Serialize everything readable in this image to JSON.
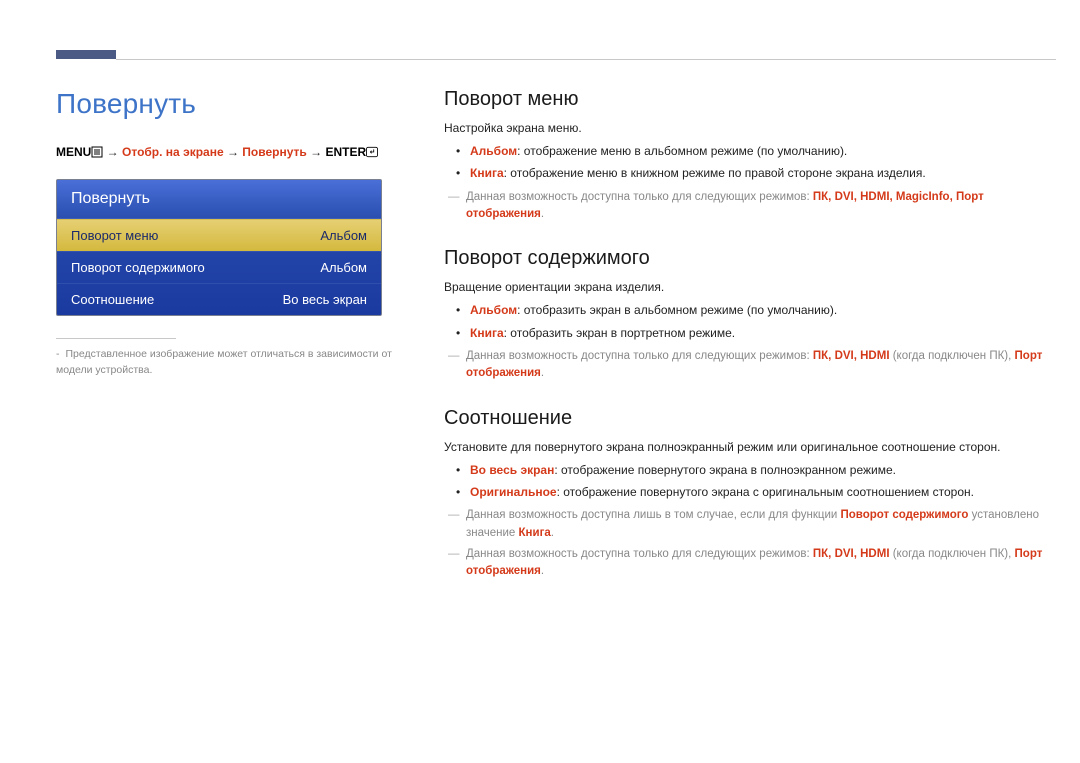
{
  "page_title": "Повернуть",
  "breadcrumb": {
    "menu_label": "MENU",
    "arrow": " → ",
    "p1": "Отобр. на экране",
    "p2": "Повернуть",
    "enter_label": "ENTER"
  },
  "osd": {
    "title": "Повернуть",
    "rows": [
      {
        "label": "Поворот меню",
        "value": "Альбом",
        "selected": true
      },
      {
        "label": "Поворот содержимого",
        "value": "Альбом",
        "selected": false
      },
      {
        "label": "Соотношение",
        "value": "Во весь экран",
        "selected": false
      }
    ]
  },
  "left_footnote": "Представленное изображение может отличаться в зависимости от модели устройства.",
  "sections": {
    "menu_rotate": {
      "heading": "Поворот меню",
      "desc": "Настройка экрана меню.",
      "bullets": [
        {
          "term": "Альбом",
          "text": ": отображение меню в альбомном режиме (по умолчанию)."
        },
        {
          "term": "Книга",
          "text": ": отображение меню в книжном режиме по правой стороне экрана изделия."
        }
      ],
      "note_prefix": "Данная возможность доступна только для следующих режимов: ",
      "note_modes": "ПК, DVI, HDMI, MagicInfo, Порт отображения",
      "note_suffix": "."
    },
    "content_rotate": {
      "heading": "Поворот содержимого",
      "desc": "Вращение ориентации экрана изделия.",
      "bullets": [
        {
          "term": "Альбом",
          "text": ": отобразить экран в альбомном режиме (по умолчанию)."
        },
        {
          "term": "Книга",
          "text": ": отобразить экран в портретном режиме."
        }
      ],
      "note_prefix": "Данная возможность доступна только для следующих режимов: ",
      "note_modes": "ПК, DVI, HDMI",
      "note_mid": " (когда подключен ПК), ",
      "note_modes2": "Порт отображения",
      "note_suffix": "."
    },
    "ratio": {
      "heading": "Соотношение",
      "desc": "Установите для повернутого экрана полноэкранный режим или оригинальное соотношение сторон.",
      "bullets": [
        {
          "term": "Во весь экран",
          "text": ": отображение повернутого экрана в полноэкранном режиме."
        },
        {
          "term": "Оригинальное",
          "text": ": отображение повернутого экрана с оригинальным соотношением сторон."
        }
      ],
      "note1_prefix": "Данная возможность доступна лишь в том случае, если для функции ",
      "note1_term": "Поворот содержимого",
      "note1_mid": " установлено значение ",
      "note1_term2": "Книга",
      "note1_suffix": ".",
      "note2_prefix": "Данная возможность доступна только для следующих режимов: ",
      "note2_modes": "ПК, DVI, HDMI",
      "note2_mid": " (когда подключен ПК), ",
      "note2_modes2": "Порт отображения",
      "note2_suffix": "."
    }
  }
}
